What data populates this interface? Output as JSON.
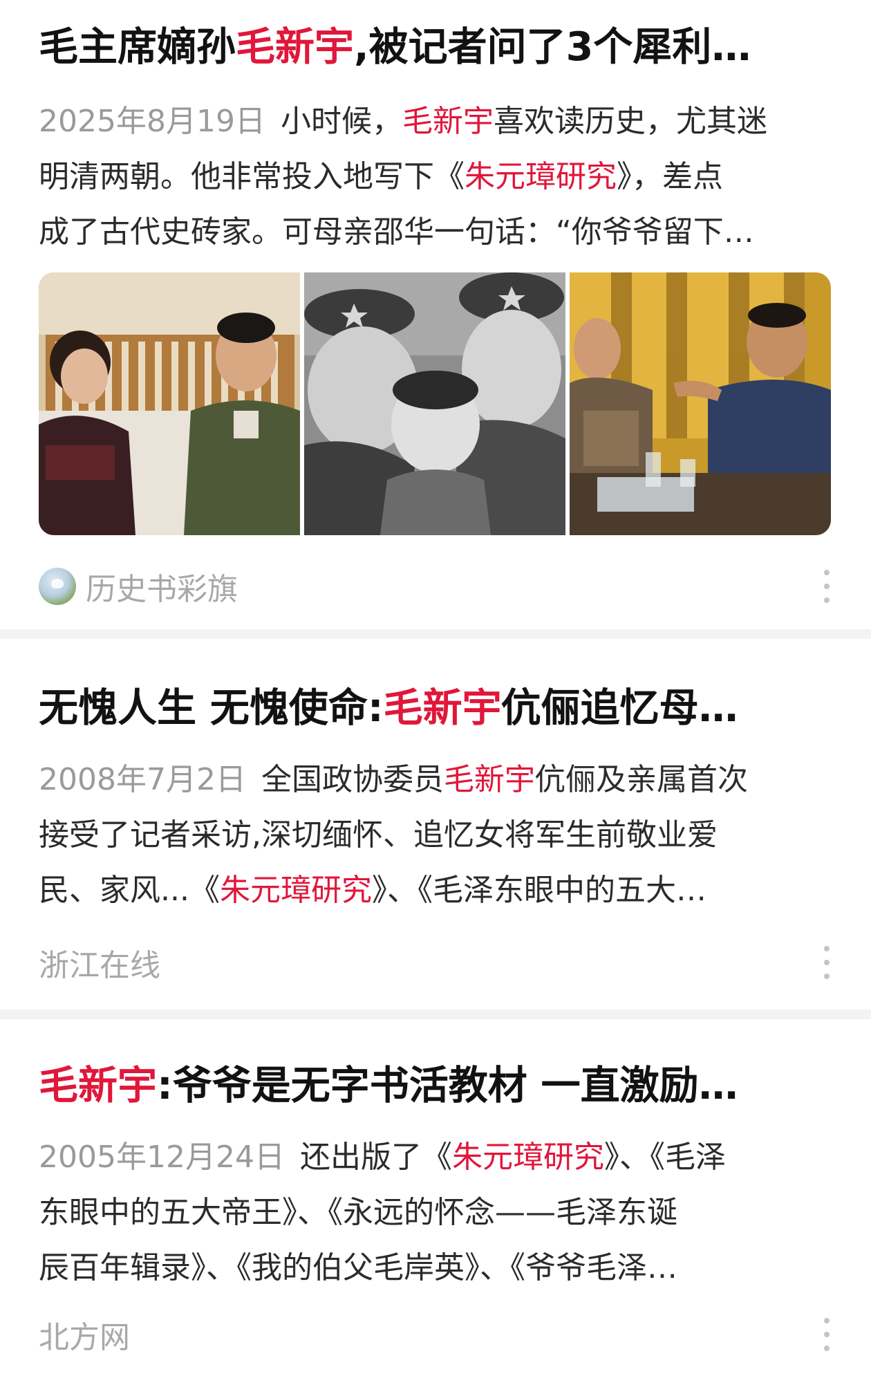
{
  "articles": [
    {
      "title": {
        "before": "毛主席嫡孙",
        "highlight": "毛新宇",
        "after": ",被记者问了3个犀利…"
      },
      "date": "2025年8月19日",
      "summary_lines": [
        {
          "a": "小时候，",
          "h": "毛新宇",
          "b": "喜欢读历史，尤其迷"
        },
        {
          "a": "明清两朝。他非常投入地写下《",
          "h": "朱元璋研究",
          "b": "》，差点"
        },
        {
          "a": "成了古代史砖家。可母亲邵华一句话：“你爷爷留下…",
          "h": "",
          "b": ""
        }
      ],
      "images": [
        "photo-woman-and-officer-on-sofa",
        "photo-bw-family-portrait",
        "photo-man-talking-in-meeting"
      ],
      "source": "历史书彩旗",
      "source_avatar": "butterfly-avatar"
    },
    {
      "title": {
        "before": "无愧人生 无愧使命:",
        "highlight": "毛新宇",
        "after": "伉俪追忆母…"
      },
      "date": "2008年7月2日",
      "summary_lines": [
        {
          "a": "全国政协委员",
          "h": "毛新宇",
          "b": "伉俪及亲属首次"
        },
        {
          "a": "接受了记者采访,深切缅怀、追忆女将军生前敬业爱",
          "h": "",
          "b": ""
        },
        {
          "a": "民、家风...《",
          "h": "朱元璋研究",
          "b": "》、《毛泽东眼中的五大…"
        }
      ],
      "source": "浙江在线"
    },
    {
      "title": {
        "before": "",
        "highlight": "毛新宇",
        "after": ":爷爷是无字书活教材 一直激励…"
      },
      "date": "2005年12月24日",
      "summary_lines": [
        {
          "a": "还出版了《",
          "h": "朱元璋研究",
          "b": "》、《毛泽"
        },
        {
          "a": "东眼中的五大帝王》、《永远的怀念——毛泽东诞",
          "h": "",
          "b": ""
        },
        {
          "a": "辰百年辑录》、《我的伯父毛岸英》、《爷爷毛泽…",
          "h": "",
          "b": ""
        }
      ],
      "source": "北方网"
    }
  ],
  "colors": {
    "highlight": "#e0173a",
    "meta": "#9a9a9a",
    "divider": "#f3f3f5"
  },
  "icons": {
    "more": "more-vertical-icon"
  }
}
